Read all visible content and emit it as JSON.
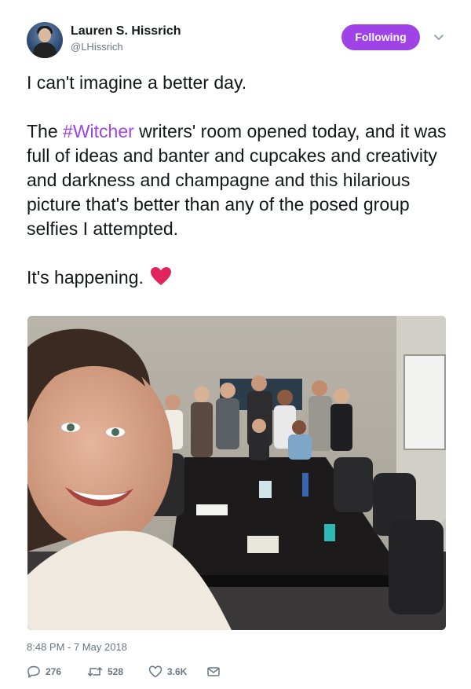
{
  "user": {
    "name": "Lauren S. Hissrich",
    "handle": "@LHissrich",
    "follow_label": "Following"
  },
  "tweet": {
    "line1": "I can't imagine a better day.",
    "para2_prefix": "The ",
    "hashtag": "#Witcher",
    "para2_suffix": " writers' room opened today, and it was full of ideas and banter and cupcakes and creativity and darkness and champagne and this hilarious picture that's better than any of the posed group selfies I attempted.",
    "line3": "It's happening.",
    "emoji": "red-heart",
    "timestamp": "8:48 PM - 7 May 2018"
  },
  "stats": {
    "replies": "276",
    "retweets": "528",
    "likes": "3.6K"
  },
  "colors": {
    "accent": "#a043e6",
    "heart": "#e0245e",
    "muted": "#657786"
  }
}
